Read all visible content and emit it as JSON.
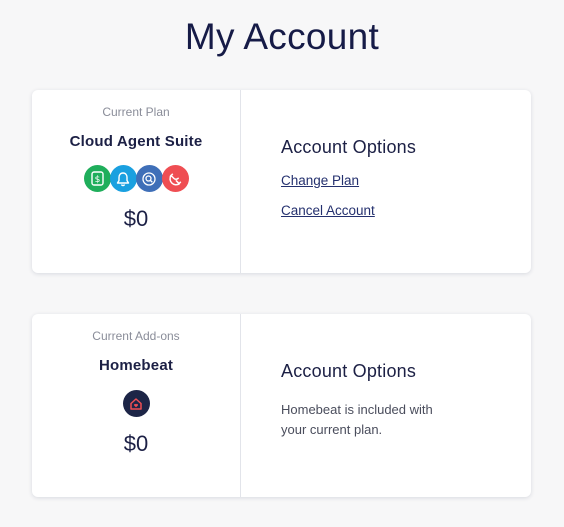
{
  "page": {
    "title": "My Account"
  },
  "plan_card": {
    "caption": "Current Plan",
    "name": "Cloud Agent Suite",
    "price": "$0",
    "icons": [
      {
        "name": "dollar-sign-icon",
        "color": "#1fae5b"
      },
      {
        "name": "bell-icon",
        "color": "#1aa0e0"
      },
      {
        "name": "search-icon",
        "color": "#3f6fb8"
      },
      {
        "name": "magnet-icon",
        "color": "#ef4e53"
      }
    ],
    "options_title": "Account Options",
    "change_plan_label": "Change Plan",
    "cancel_account_label": "Cancel Account"
  },
  "addon_card": {
    "caption": "Current Add-ons",
    "name": "Homebeat",
    "price": "$0",
    "icon": {
      "name": "homebeat-house-icon",
      "color": "#1d2547"
    },
    "options_title": "Account Options",
    "info_text": "Homebeat is included with your current plan."
  }
}
